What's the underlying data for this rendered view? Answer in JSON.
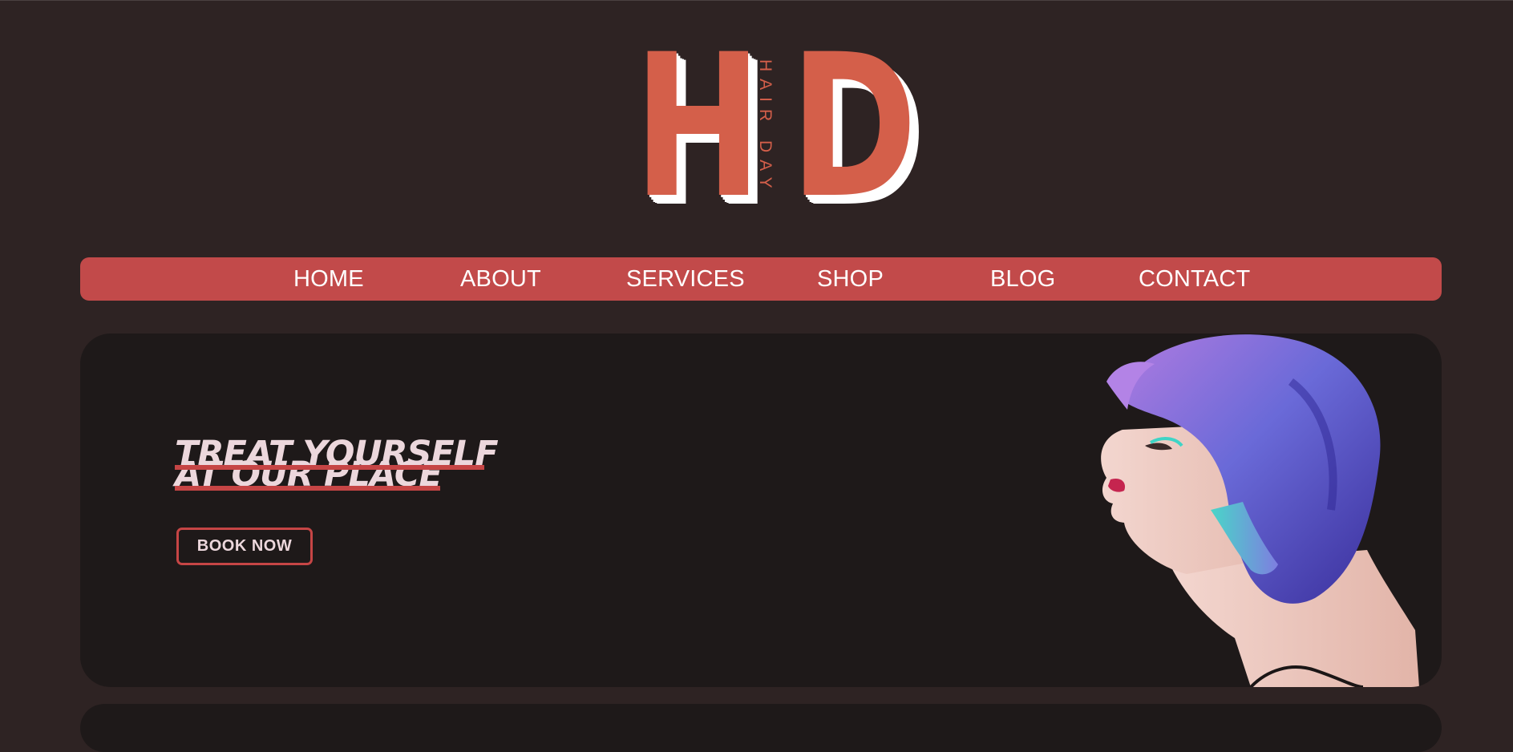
{
  "logo": {
    "letter_left": "H",
    "letter_right": "D",
    "vertical_text": "HAIR DAY",
    "color": "#d45f4a",
    "shadow_color": "#ffffff"
  },
  "nav": {
    "background": "#c24a4a",
    "items": [
      {
        "label": "HOME"
      },
      {
        "label": "ABOUT"
      },
      {
        "label": "SERVICES"
      },
      {
        "label": "SHOP"
      },
      {
        "label": "BLOG"
      },
      {
        "label": "CONTACT"
      }
    ]
  },
  "hero": {
    "headline_line1": "TREAT YOURSELF",
    "headline_line2": "AT OUR PLACE",
    "book_button_label": "BOOK NOW",
    "accent": "#c64545",
    "text_color": "#ecd7dc"
  },
  "colors": {
    "page_background": "#2e2323",
    "card_background": "#1e1919"
  }
}
